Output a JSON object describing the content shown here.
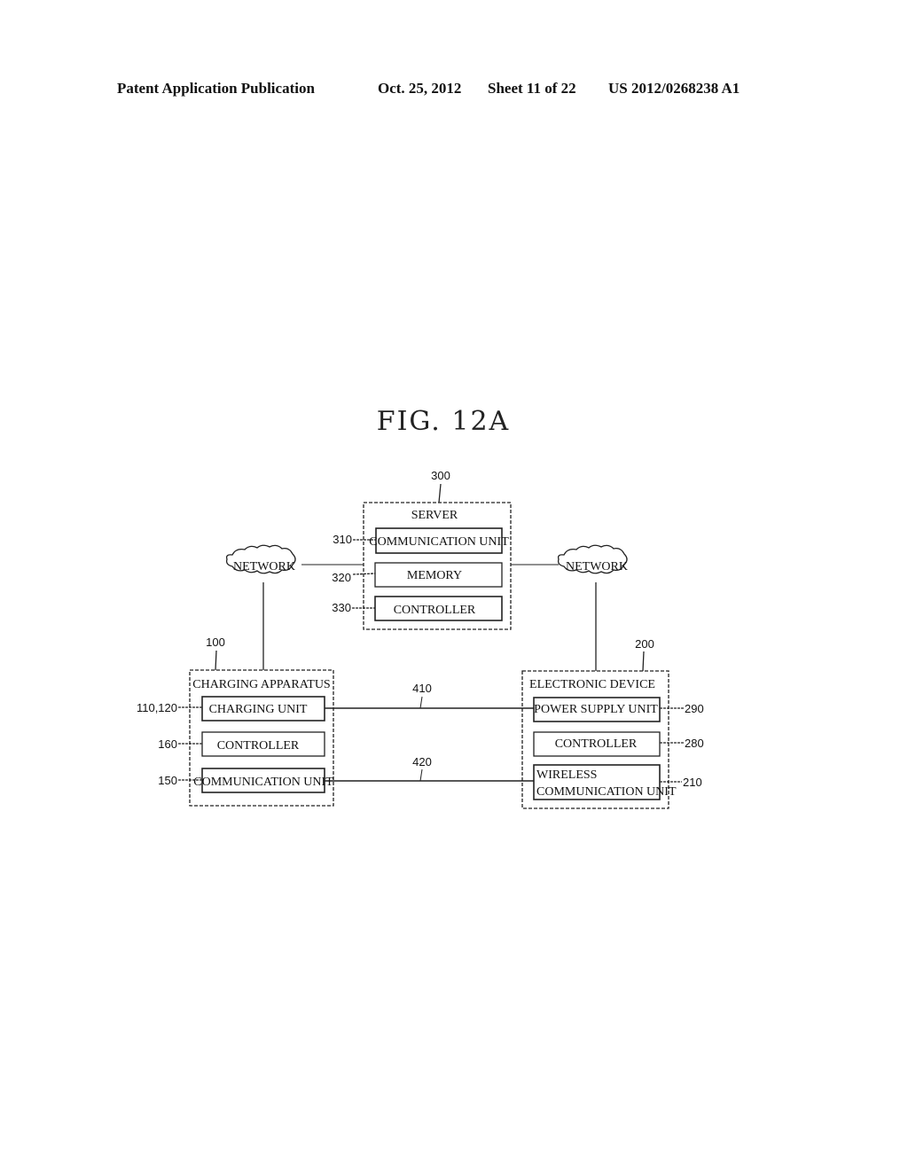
{
  "header": {
    "publication": "Patent Application Publication",
    "date": "Oct. 25, 2012",
    "sheet": "Sheet 11 of 22",
    "patent_number": "US 2012/0268238 A1"
  },
  "figure": {
    "title": "FIG. 12A"
  },
  "server": {
    "ref": "300",
    "title": "SERVER",
    "units": [
      {
        "ref": "310",
        "label": "COMMUNICATION UNIT"
      },
      {
        "ref": "320",
        "label": "MEMORY"
      },
      {
        "ref": "330",
        "label": "CONTROLLER"
      }
    ]
  },
  "networks": [
    {
      "label": "NETWORK"
    },
    {
      "label": "NETWORK"
    }
  ],
  "charging_apparatus": {
    "ref": "100",
    "title": "CHARGING APPARATUS",
    "units": [
      {
        "ref": "110,120",
        "label": "CHARGING UNIT"
      },
      {
        "ref": "160",
        "label": "CONTROLLER"
      },
      {
        "ref": "150",
        "label": "COMMUNICATION UNIT"
      }
    ]
  },
  "electronic_device": {
    "ref": "200",
    "title": "ELECTRONIC DEVICE",
    "units": [
      {
        "ref": "290",
        "label": "POWER SUPPLY UNIT"
      },
      {
        "ref": "280",
        "label": "CONTROLLER"
      },
      {
        "ref": "210",
        "label_line1": "WIRELESS",
        "label_line2": "COMMUNICATION UNIT"
      }
    ]
  },
  "links": [
    {
      "ref": "410"
    },
    {
      "ref": "420"
    }
  ]
}
